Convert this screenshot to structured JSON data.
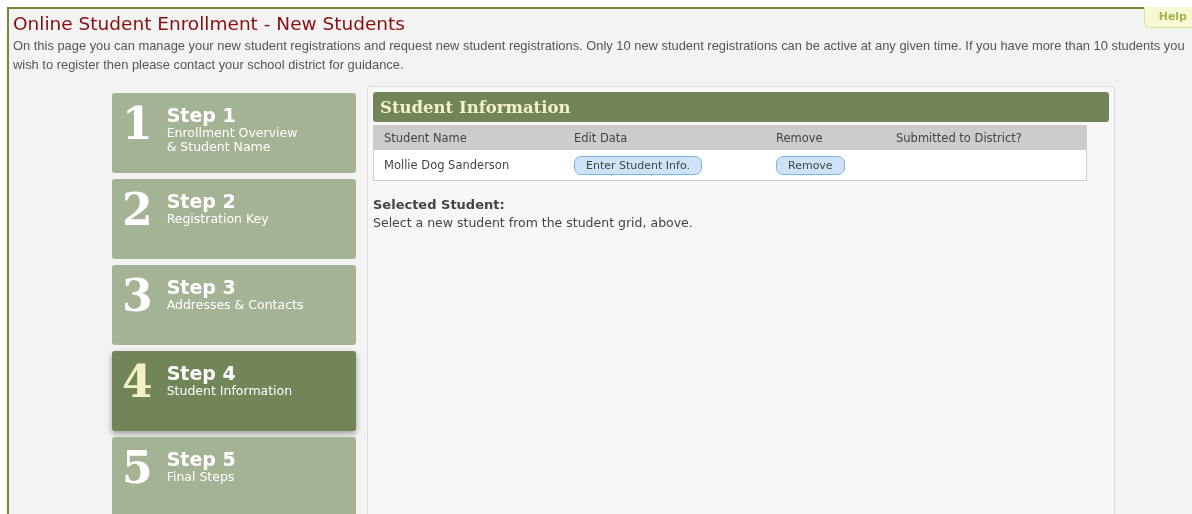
{
  "page": {
    "title": "Online Student Enrollment - New Students",
    "help": "Help",
    "description_lines": [
      "On this page you can manage your new student registrations and request new student registrations. Only 10 new student registrations can be active at any given time. If you have more than 10 students you",
      "wish to register then please contact your school district for guidance."
    ]
  },
  "steps": [
    {
      "number": "1",
      "title": "Step 1",
      "subtitle_lines": [
        "Enrollment Overview",
        "& Student Name"
      ],
      "selected": false
    },
    {
      "number": "2",
      "title": "Step 2",
      "subtitle_lines": [
        "Registration Key"
      ],
      "selected": false
    },
    {
      "number": "3",
      "title": "Step 3",
      "subtitle_lines": [
        "Addresses & Contacts"
      ],
      "selected": false
    },
    {
      "number": "4",
      "title": "Step 4",
      "subtitle_lines": [
        "Student Information"
      ],
      "selected": true
    },
    {
      "number": "5",
      "title": "Step 5",
      "subtitle_lines": [
        "Final Steps"
      ],
      "selected": false
    }
  ],
  "panel": {
    "title": "Student Information",
    "table": {
      "columns": [
        "Student Name",
        "Edit Data",
        "Remove",
        "Submitted to District?"
      ],
      "rows": [
        {
          "student_name": "Mollie Dog Sanderson",
          "edit_button": "Enter Student Info.",
          "remove_button": "Remove"
        }
      ]
    },
    "selected_student": {
      "heading": "Selected Student:",
      "hint": "Select a new student from the student grid, above."
    }
  }
}
